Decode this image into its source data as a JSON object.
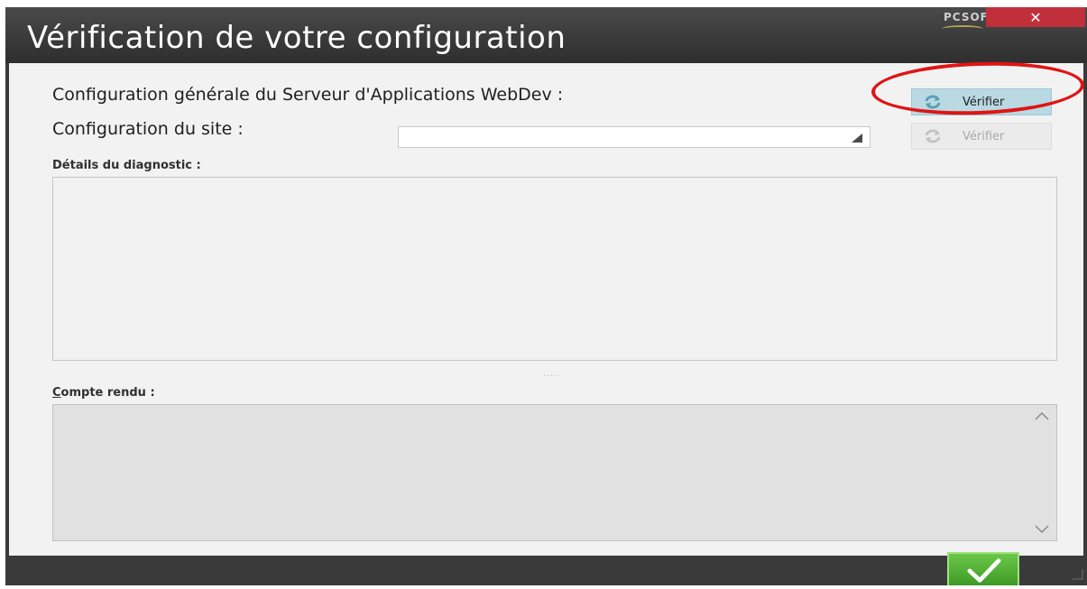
{
  "window": {
    "title": "Vérification de votre configuration",
    "brand": "PCSOFT",
    "close_glyph": "✕"
  },
  "form": {
    "general_label": "Configuration générale du Serveur d'Applications WebDev :",
    "site_label": "Configuration du site :",
    "site_value": "",
    "verify_general_label": "Vérifier",
    "verify_site_label": "Vérifier",
    "details_label": "Détails du diagnostic :",
    "details_text": "",
    "report_label_first": "C",
    "report_label_rest": "ompte rendu :",
    "report_text": "",
    "splitter_glyph": "....."
  },
  "footer": {
    "ok_icon": "checkmark-icon"
  },
  "icons": {
    "refresh": "refresh-icon",
    "dropdown": "dropdown-arrow-icon",
    "scroll_up": "chevron-up-icon",
    "scroll_down": "chevron-down-icon"
  },
  "colors": {
    "titlebar": "#3a3a3a",
    "close": "#c0303a",
    "primary_button": "#b9d9e3",
    "ok_button": "#4caf2e",
    "annotation": "#e01414"
  }
}
